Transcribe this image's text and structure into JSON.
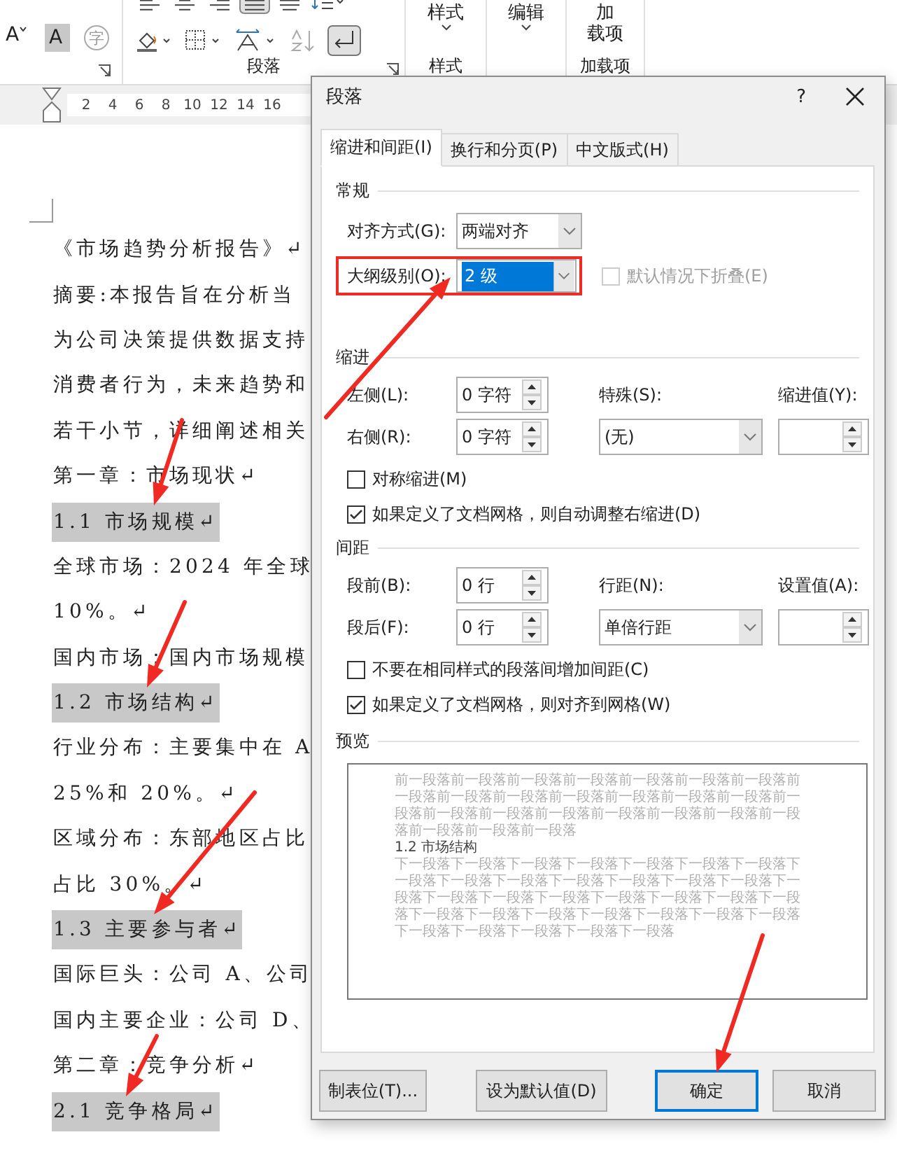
{
  "ribbon": {
    "font_buttons": [
      {
        "label": "A",
        "kind": "grow"
      },
      {
        "label": "A",
        "kind": "shade"
      },
      {
        "label": "字",
        "kind": "enclose"
      }
    ],
    "align_buttons": [
      {
        "kind": "left",
        "selected": false
      },
      {
        "kind": "center",
        "selected": false
      },
      {
        "kind": "right",
        "selected": false
      },
      {
        "kind": "justify",
        "selected": true
      },
      {
        "kind": "distributed",
        "selected": false
      }
    ],
    "show_marks": {
      "selected": true
    },
    "group_labels": [
      "段落",
      "样式",
      "加载项"
    ],
    "large_buttons": [
      {
        "lines": [
          "样式"
        ]
      },
      {
        "lines": [
          "编辑"
        ]
      },
      {
        "lines": [
          "加",
          "载项"
        ]
      }
    ]
  },
  "ruler": {
    "ticks": [
      "2",
      "4",
      "6",
      "8",
      "10",
      "12",
      "14",
      "16"
    ]
  },
  "document": {
    "lines": [
      {
        "text": "《市场趋势分析报告》↵",
        "highlighted": false
      },
      {
        "text": "摘要:本报告旨在分析当",
        "highlighted": false
      },
      {
        "text": "为公司决策提供数据支持",
        "highlighted": false
      },
      {
        "text": "消费者行为，未来趋势和",
        "highlighted": false
      },
      {
        "text": "若干小节，详细阐述相关",
        "highlighted": false
      },
      {
        "text": "第一章：市场现状↵",
        "highlighted": false
      },
      {
        "text": "1.1 市场规模↵",
        "highlighted": true
      },
      {
        "text": "全球市场：2024 年全球",
        "highlighted": false
      },
      {
        "text": "10%。↵",
        "highlighted": false
      },
      {
        "text": "国内市场：国内市场规模",
        "highlighted": false
      },
      {
        "text": "1.2 市场结构↵",
        "highlighted": true
      },
      {
        "text": "行业分布：主要集中在 A",
        "highlighted": false
      },
      {
        "text": "25%和 20%。↵",
        "highlighted": false
      },
      {
        "text": "区域分布：东部地区占比",
        "highlighted": false
      },
      {
        "text": "占比 30%。↵",
        "highlighted": false
      },
      {
        "text": "1.3 主要参与者↵",
        "highlighted": true
      },
      {
        "text": "国际巨头：公司 A、公司",
        "highlighted": false
      },
      {
        "text": "国内主要企业：公司 D、",
        "highlighted": false
      },
      {
        "text": "第二章：竞争分析↵",
        "highlighted": false
      },
      {
        "text": "2.1 竞争格局↵",
        "highlighted": true
      }
    ]
  },
  "dialog": {
    "title": "段落",
    "help": "?",
    "tabs": [
      {
        "label": "缩进和间距(I)",
        "selected": true
      },
      {
        "label": "换行和分页(P)",
        "selected": false
      },
      {
        "label": "中文版式(H)",
        "selected": false
      }
    ],
    "general": {
      "title": "常规",
      "alignment": {
        "label": "对齐方式(G):",
        "value": "两端对齐"
      },
      "outline_level": {
        "label": "大纲级别(O):",
        "value": "2 级",
        "highlighted": true
      },
      "collapse": {
        "label": "默认情况下折叠(E)",
        "checked": false,
        "disabled": true
      }
    },
    "indent": {
      "title": "缩进",
      "left": {
        "label": "左侧(L):",
        "value": "0 字符"
      },
      "right": {
        "label": "右侧(R):",
        "value": "0 字符"
      },
      "special": {
        "label": "特殊(S):",
        "value": "(无)"
      },
      "by": {
        "label": "缩进值(Y):"
      },
      "checkboxes": [
        {
          "label": "对称缩进(M)",
          "checked": false
        },
        {
          "label": "如果定义了文档网格，则自动调整右缩进(D)",
          "checked": true
        }
      ]
    },
    "spacing": {
      "title": "间距",
      "before": {
        "label": "段前(B):",
        "value": "0 行"
      },
      "after": {
        "label": "段后(F):",
        "value": "0 行"
      },
      "line_spacing": {
        "label": "行距(N):",
        "value": "单倍行距"
      },
      "at": {
        "label": "设置值(A):"
      },
      "checkboxes": [
        {
          "label": "不要在相同样式的段落间增加间距(C)",
          "checked": false
        },
        {
          "label": "如果定义了文档网格，则对齐到网格(W)",
          "checked": true
        }
      ]
    },
    "preview": {
      "title": "预览",
      "previous": "前一段落前一段落前一段落前一段落前一段落前一段落前一段落前一段落前一段落前一段落前一段落前一段落前一段落前一段落前一段落前一段落前一段落前一段落前一段落前一段落前一段落前一段落前一段落前一段落前一段落",
      "current": "1.2 市场结构",
      "next": "下一段落下一段落下一段落下一段落下一段落下一段落下一段落下一段落下一段落下一段落下一段落下一段落下一段落下一段落下一段落下一段落下一段落下一段落下一段落下一段落下一段落下一段落下一段落下一段落下一段落下一段落下一段落下一段落下一段落下一段落下一段落下一段落下一段落下一段落"
    },
    "buttons": [
      {
        "label": "制表位(T)...",
        "default": false
      },
      {
        "label": "设为默认值(D)",
        "default": false
      },
      {
        "label": "确定",
        "default": true
      },
      {
        "label": "取消",
        "default": false
      }
    ]
  }
}
